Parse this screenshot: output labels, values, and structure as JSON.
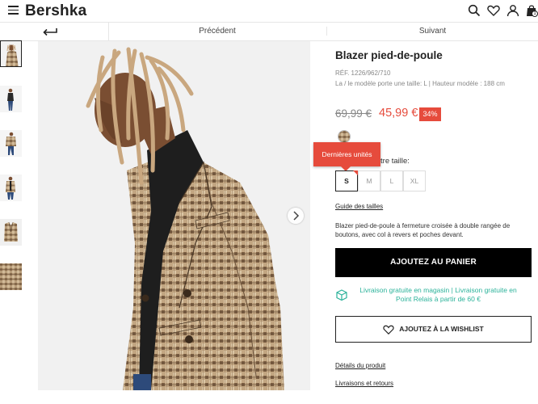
{
  "header": {
    "logo": "Bershka",
    "icons": [
      "menu-icon",
      "search-icon",
      "heart-icon",
      "user-icon",
      "bag-icon"
    ],
    "cart_count": "1"
  },
  "nav": {
    "previous": "Précédent",
    "next": "Suivant"
  },
  "gallery": {
    "thumbnails": [
      "thumb-1",
      "thumb-2",
      "thumb-3",
      "thumb-4",
      "thumb-5",
      "thumb-6"
    ],
    "active_thumbnail": 0
  },
  "product": {
    "title": "Blazer pied-de-poule",
    "ref": "RÉF. 1226/962/710",
    "model_info": "La / le modèle porte une taille: L | Hauteur modèle : 188 cm",
    "old_price": "69,99 €",
    "new_price": "45,99 €",
    "discount": "34%",
    "size_prompt": "votre taille:",
    "tooltip": "Dernières unités",
    "sizes": [
      "S",
      "M",
      "L",
      "XL"
    ],
    "selected_size": "S",
    "size_guide": "Guide des tailles",
    "description": "Blazer pied-de-poule à fermeture croisée à double rangée de boutons, avec col à revers et poches devant.",
    "add_to_cart": "AJOUTEZ AU PANIER",
    "delivery": "Livraison gratuite en magasin | Livraison gratuite en Point Relais à partir de 60 €",
    "wishlist": "AJOUTEZ À LA WISHLIST",
    "details_link": "Détails du produit",
    "returns_link": "Livraisons et retours"
  },
  "colors": {
    "accent_red": "#e64b3c",
    "delivery_green": "#2bb29a",
    "button_black": "#000000"
  }
}
